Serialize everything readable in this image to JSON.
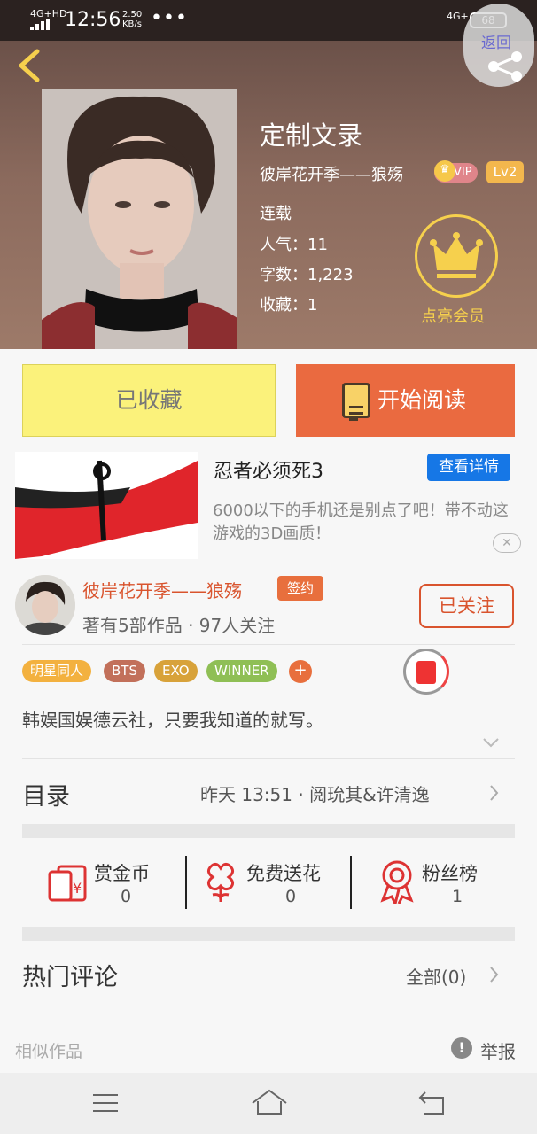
{
  "status_bar": {
    "network": "4G+HD",
    "time": "12:56",
    "speed_value": "2.50",
    "speed_unit": "KB/s",
    "more": "•••",
    "network_right": "4G+",
    "battery": "68"
  },
  "header": {
    "book_title": "定制文录",
    "author_line": "彼岸花开季——狼殇",
    "vip_label": "VIP",
    "level": "Lv2",
    "status": "连载",
    "popularity": "人气：11",
    "word_count": "字数：1,223",
    "favorites": "收藏：1",
    "member_label": "点亮会员",
    "share_back_label": "返回"
  },
  "actions": {
    "favorite_label": "已收藏",
    "read_label": "开始阅读"
  },
  "ad": {
    "title": "忍者必须死3",
    "detail_label": "查看详情",
    "description": "6000以下的手机还是别点了吧！带不动这游戏的3D画质！",
    "close_icon": "close-icon"
  },
  "author": {
    "name": "彼岸花开季——狼殇",
    "signed_label": "签约",
    "stats": "著有5部作品 · 97人关注",
    "follow_label": "已关注"
  },
  "tags": [
    {
      "label": "明星同人",
      "color": "#f3b13f"
    },
    {
      "label": "BTS",
      "color": "#c2705a"
    },
    {
      "label": "EXO",
      "color": "#d8a23a"
    },
    {
      "label": "WINNER",
      "color": "#8fbf55"
    }
  ],
  "tag_more": "+",
  "intro": "韩娱国娱德云社，只要我知道的就写。",
  "toc": {
    "label": "目录",
    "latest": "昨天 13:51 · 阅玧其&许清逸"
  },
  "stats": [
    {
      "label": "赏金币",
      "value": "0",
      "icon": "coin-red-envelope-icon"
    },
    {
      "label": "免费送花",
      "value": "0",
      "icon": "flower-icon"
    },
    {
      "label": "粉丝榜",
      "value": "1",
      "icon": "medal-icon"
    }
  ],
  "comments": {
    "label": "热门评论",
    "all_label": "全部(0)"
  },
  "footer": {
    "similar_label": "相似作品",
    "report_label": "举报"
  },
  "colors": {
    "accent_orange": "#ea6a40",
    "favorite_yellow": "#fbf27b",
    "author_red": "#d9542e",
    "ad_blue": "#1677e6"
  }
}
